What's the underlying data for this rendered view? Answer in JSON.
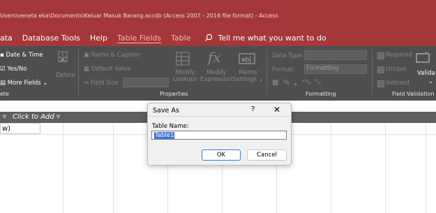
{
  "titlebar": {
    "path_text": "Users\\veneta eka\\Documents\\Keluar Masuk Barang.accdb (Access 2007 - 2016 file format) - Access"
  },
  "menu": {
    "items": [
      {
        "label": "ata"
      },
      {
        "label": "Database Tools"
      },
      {
        "label": "Help"
      },
      {
        "label": "Table Fields"
      },
      {
        "label": "Table"
      }
    ],
    "tell_me": "Tell me what you want to do"
  },
  "ribbon": {
    "add_delete": {
      "date_time": "Date & Time",
      "yes_no": "Yes/No",
      "more_fields": "More Fields ⌄",
      "delete_label": "Delete",
      "group_label": "ete"
    },
    "properties": {
      "name_caption": "Name & Caption",
      "default_value": "Default Value",
      "field_size": "Field Size",
      "modify_lookups_1": "Modify",
      "modify_lookups_2": "Lookups",
      "modify_expression_1": "Modify",
      "modify_expression_2": "Expression",
      "memo_settings_1": "Memo",
      "memo_settings_2": "Settings ⌄",
      "group_label": "Properties"
    },
    "formatting": {
      "data_type_label": "Data Type:",
      "format_label": "Format:",
      "format_value": "Formatting",
      "group_label": "Formatting"
    },
    "field_validation": {
      "required": "Required",
      "unique": "Unique",
      "indexed": "Indexed",
      "validation": "Valida",
      "group_label": "Field Validation"
    }
  },
  "grid": {
    "click_to_add": "Click to Add",
    "new_row": "w)"
  },
  "dialog": {
    "title": "Save As",
    "help": "?",
    "close": "✕",
    "table_name_label": "Table Name:",
    "table_name_value": "Table1",
    "ok_label": "OK",
    "cancel_label": "Cancel"
  },
  "colors": {
    "title_accent": "#a4373a",
    "ribbon_bg": "#4e4e4e",
    "selection": "#3b78d8"
  }
}
